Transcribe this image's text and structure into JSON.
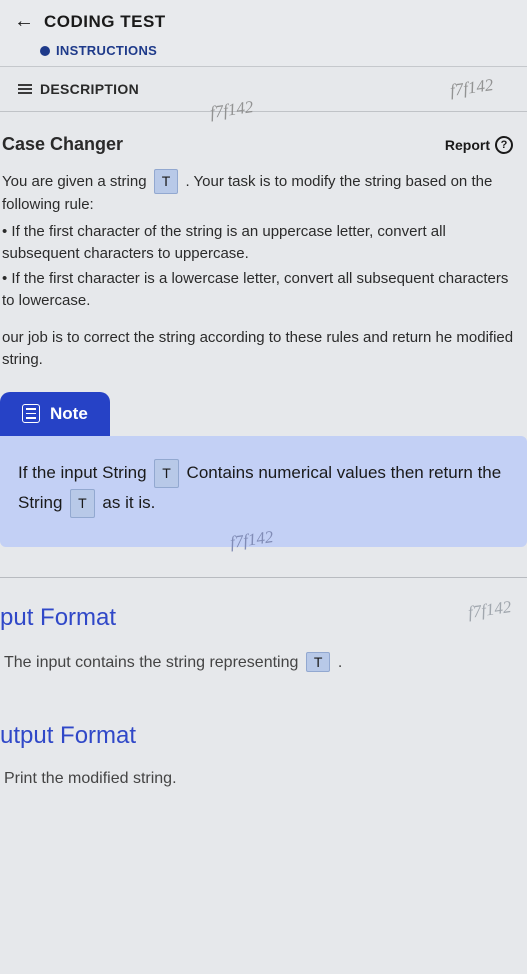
{
  "header": {
    "title": "CODING TEST",
    "instructions_label": "INSTRUCTIONS"
  },
  "tabs": {
    "description": "DESCRIPTION"
  },
  "problem": {
    "title": "Case Changer",
    "report_label": "Report",
    "intro_pre": "You are given a string ",
    "intro_code": "T",
    "intro_post": " . Your task is to modify the string based on the following rule:",
    "rule1": "If the first character of the string is an uppercase letter, convert all subsequent characters to uppercase.",
    "rule2": "If the first character is a lowercase letter, convert all subsequent characters to lowercase.",
    "summary": "our job is to correct the string according to these rules and return he modified string."
  },
  "note": {
    "header": "Note",
    "body_pre": "If the input String ",
    "body_code1": "T",
    "body_mid": " Contains numerical values then return the String ",
    "body_code2": "T",
    "body_post": " as it is."
  },
  "input_format": {
    "title": "put Format",
    "body_pre": "The input contains the string representing ",
    "body_code": "T",
    "body_post": " ."
  },
  "output_format": {
    "title": "utput Format",
    "body": "Print the modified string."
  },
  "watermark": "f7f142"
}
